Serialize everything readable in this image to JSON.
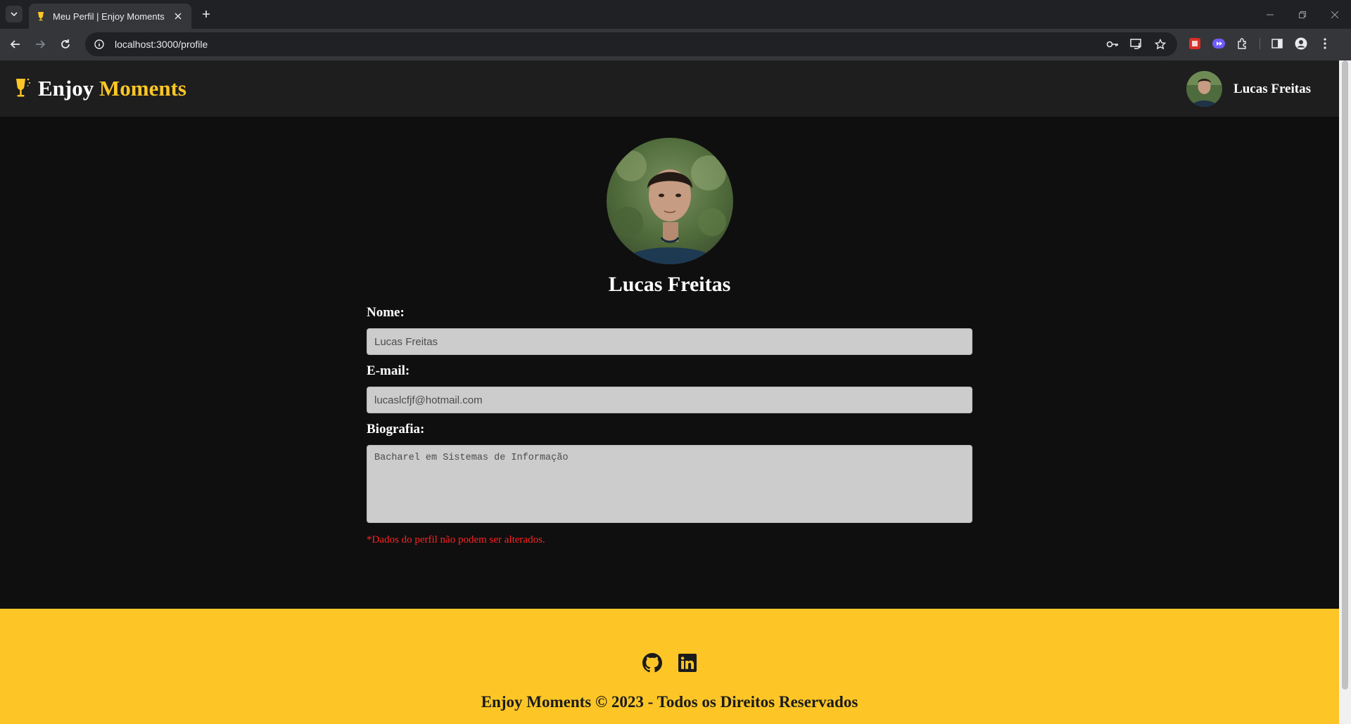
{
  "browser": {
    "tab_title": "Meu Perfil | Enjoy Moments",
    "url": "localhost:3000/profile"
  },
  "header": {
    "logo_main": "Enjoy",
    "logo_accent": "Moments",
    "user_name": "Lucas Freitas"
  },
  "profile": {
    "name": "Lucas Freitas",
    "name_label": "Nome:",
    "name_value": "Lucas Freitas",
    "email_label": "E-mail:",
    "email_value": "lucaslcfjf@hotmail.com",
    "bio_label": "Biografia:",
    "bio_value": "Bacharel em Sistemas de Informação",
    "notice": "*Dados do perfil não podem ser alterados."
  },
  "footer": {
    "copyright": "Enjoy Moments © 2023 - Todos os Direitos Reservados"
  },
  "icons": {
    "github": "github-icon",
    "linkedin": "linkedin-icon",
    "logo": "wine-glass-icon"
  },
  "colors": {
    "accent": "#fdc626",
    "page_bg": "#0f0f0f",
    "header_bg": "#1e1e1e",
    "input_bg": "#cccccc",
    "notice": "#ff2222"
  }
}
